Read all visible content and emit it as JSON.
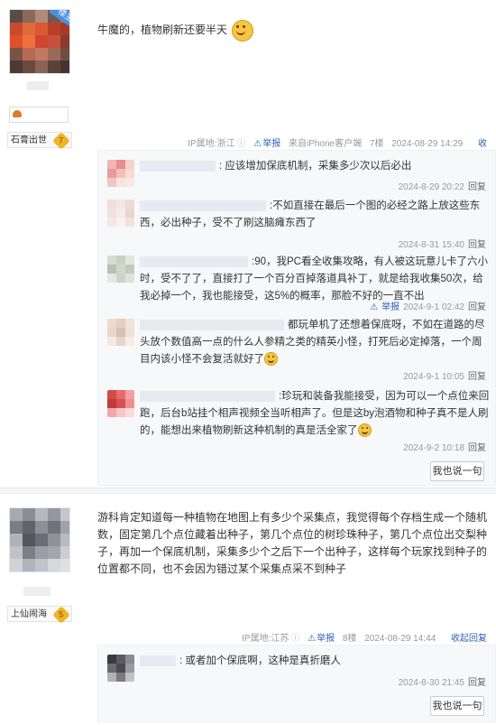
{
  "post1": {
    "owner_badge": "楼主",
    "level_name": "石膏出世",
    "level_num": "7",
    "content": "牛魔的，植物刷新还要半天",
    "tail": {
      "ip": "IP属地:浙江",
      "report": "举报",
      "source": "来自iPhone客户端",
      "floor": "7楼",
      "time": "2024-08-29 14:29",
      "collapse": "收起回复"
    },
    "replies": [
      {
        "text": "应该增加保底机制，采集多少次以后必出",
        "time": "2024-8-29 20:22",
        "reply": "回复"
      },
      {
        "text": "不如直接在最后一个图的必经之路上放这些东西，必出种子，受不了刷这脑瘫东西了",
        "time": "2024-8-31 15:40",
        "reply": "回复"
      },
      {
        "text": "90，我PC看全收集攻略，有人被这玩意儿卡了六小时，受不了了，直接打了一个百分百掉落道具补丁，就是给我收集50次，给我必掉一个，我也能接受，这5%的概率，那脸不好的一直不出",
        "time": "2024-9-1 02:42",
        "report": "举报",
        "reply": "回复"
      },
      {
        "text": "都玩单机了还想着保底呀，不如在道路的尽头放个数值高一点的什么人参精之类的精英小怪，打死后必定掉落，一个周目内该小怪不会复活就好了",
        "time": "2024-9-1 10:05",
        "reply": "回复"
      },
      {
        "text": "珍玩和装备我能接受，因为可以一个点位来回跑，后台b站挂个相声视频全当听相声了。但是这by泡酒物和种子真不是人刷的，能想出来植物刷新这种机制的真是活全家了",
        "time": "2024-9-2 10:18",
        "reply": "回复"
      }
    ],
    "say_button": "我也说一句"
  },
  "post2": {
    "level_name": "上仙闹海",
    "level_num": "5",
    "content": "游科肯定知道每一种植物在地图上有多少个采集点，我觉得每个存档生成一个随机数，固定第几个点位藏着出种子，第几个点位的树珍珠种子，第几个点位出交梨种子，再加一个保底机制，采集多少个之后下一个出种子，这样每个玩家找到种子的位置都不同，也不会因为错过某个采集点采不到种子",
    "tail": {
      "ip": "IP属地:江苏",
      "report": "举报",
      "floor": "8楼",
      "time": "2024-08-29 14:44",
      "collapse": "收起回复"
    },
    "replies": [
      {
        "text": "或者加个保底啊，这种是真折磨人",
        "time": "2024-8-30 21:45",
        "reply": "回复"
      }
    ],
    "say_button": "我也说一句"
  },
  "colors": {
    "link": "#2d64b3",
    "meta": "#999999",
    "reply_bg": "#f7f8fa"
  }
}
